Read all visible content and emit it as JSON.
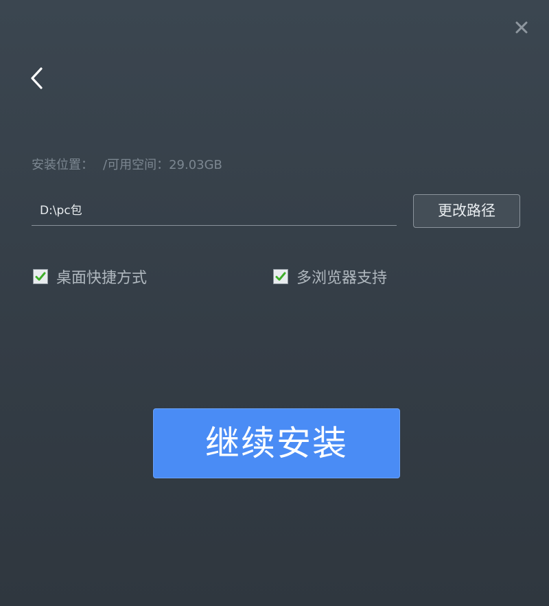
{
  "window": {
    "close_icon": "close-icon",
    "back_icon": "chevron-left-icon"
  },
  "install_location": {
    "label": "安装位置：",
    "free_space": "/可用空间：29.03GB",
    "path_value": "D:\\pc包",
    "change_path_label": "更改路径"
  },
  "options": [
    {
      "label": "桌面快捷方式",
      "checked": true,
      "icon": "checkmark-icon"
    },
    {
      "label": "多浏览器支持",
      "checked": true,
      "icon": "checkmark-icon"
    }
  ],
  "continue_label": "继续安装",
  "colors": {
    "background": "#3b4650",
    "accent": "#4a8cf5",
    "check_green": "#3fae29"
  }
}
